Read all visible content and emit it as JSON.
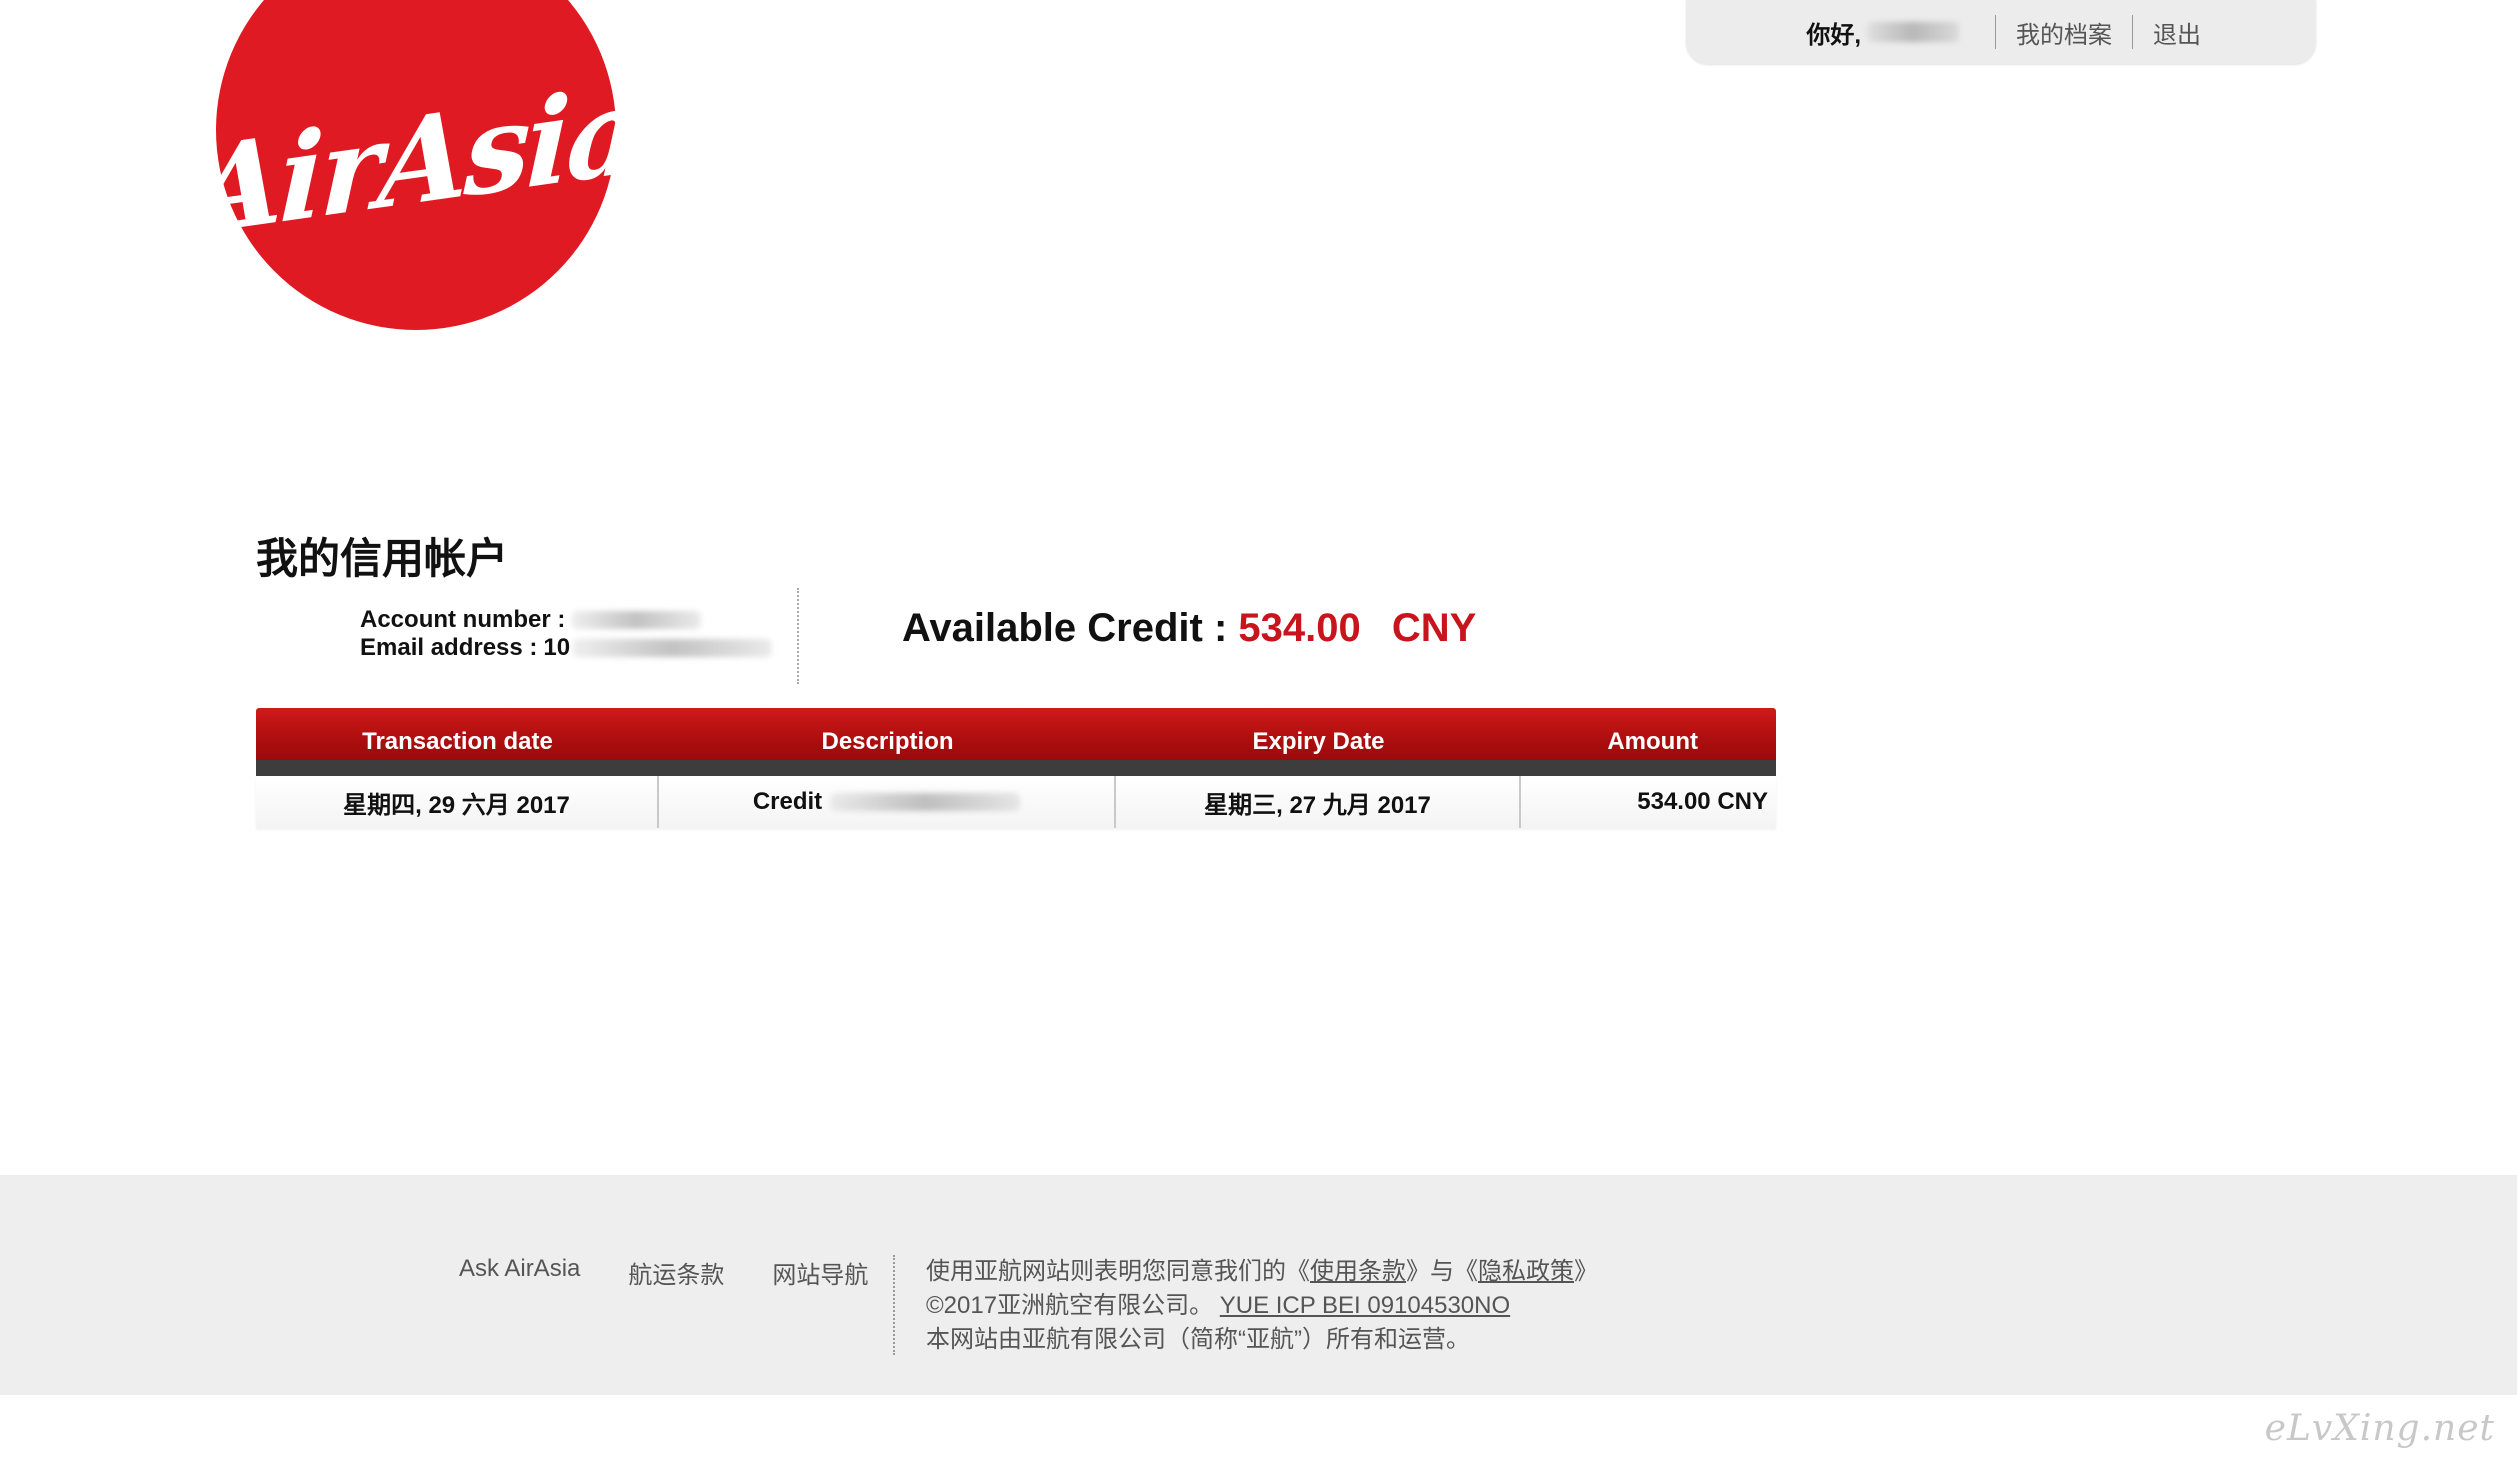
{
  "brand": {
    "logo_text": "AirAsia",
    "logo_color": "#e01a22"
  },
  "userbar": {
    "greeting": "你好,",
    "profile_link": "我的档案",
    "logout_link": "退出"
  },
  "page": {
    "title": "我的信用帐户"
  },
  "account": {
    "number_label": "Account number :",
    "email_label": "Email address :",
    "email_visible_prefix": "10"
  },
  "credit": {
    "label": "Available Credit :",
    "value": "534.00",
    "currency": "CNY",
    "value_color": "#c8141c"
  },
  "table": {
    "headers": [
      "Transaction date",
      "Description",
      "Expiry Date",
      "Amount"
    ],
    "rows": [
      {
        "transaction_date": "星期四, 29 六月 2017",
        "description": "Credit",
        "expiry_date": "星期三, 27 九月 2017",
        "amount": "534.00 CNY"
      }
    ]
  },
  "footer": {
    "links": [
      "Ask AirAsia",
      "航运条款",
      "网站导航"
    ],
    "line1_prefix": "使用亚航网站则表明您同意我们的《",
    "terms_link": "使用条款",
    "line1_mid": "》与《",
    "privacy_link": "隐私政策",
    "line1_suffix": "》",
    "line2_prefix": "©2017亚洲航空有限公司。 ",
    "icp_link": "YUE ICP BEI 09104530NO",
    "line3": "本网站由亚航有限公司（简称“亚航”）所有和运营。"
  },
  "watermark": "eLvXing.net"
}
